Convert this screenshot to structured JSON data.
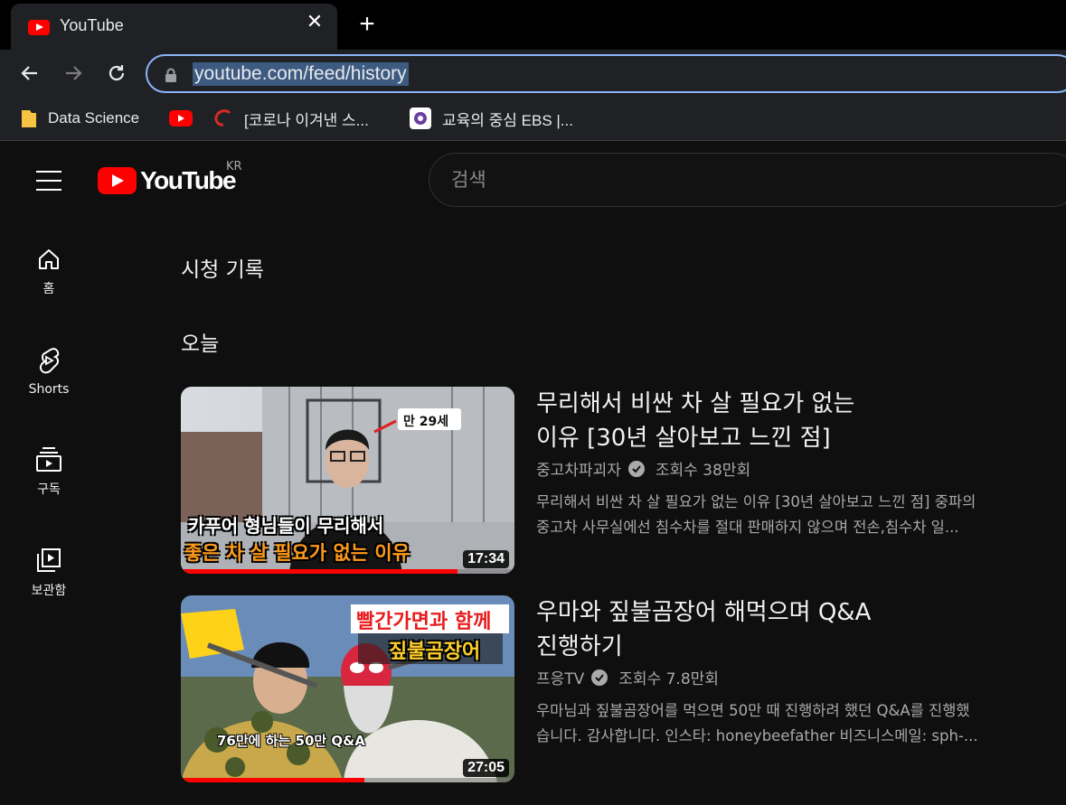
{
  "browser": {
    "tab_title": "YouTube",
    "tab_close": "✕",
    "new_tab": "+",
    "url": "youtube.com/feed/history",
    "bookmarks": [
      {
        "label": "Data Science",
        "icon": "folder-icon"
      },
      {
        "label": "",
        "icon": "youtube-icon"
      },
      {
        "label": "[코로나 이겨낸 스...",
        "icon": "red-swirl-icon"
      },
      {
        "label": "교육의 중심 EBS |...",
        "icon": "ebs-icon"
      }
    ]
  },
  "header": {
    "logo_text": "YouTube",
    "region": "KR",
    "search_placeholder": "검색"
  },
  "sidebar": {
    "items": [
      {
        "label": "홈",
        "icon": "home-icon"
      },
      {
        "label": "Shorts",
        "icon": "shorts-icon"
      },
      {
        "label": "구독",
        "icon": "subscriptions-icon"
      },
      {
        "label": "보관함",
        "icon": "library-icon"
      }
    ]
  },
  "main": {
    "page_title": "시청 기록",
    "section_title": "오늘",
    "videos": [
      {
        "title_line1": "무리해서 비싼 차 살 필요가 없는",
        "title_line2": "이유 [30년 살아보고 느낀 점]",
        "channel": "중고차파괴자",
        "views": "조회수 38만회",
        "desc_line1": "무리해서 비싼 차 살 필요가 없는 이유 [30년 살아보고 느낀 점] 중파의",
        "desc_line2": "중고차 사무실에선 침수차를 절대 판매하지 않으며 전손,침수차 일...",
        "duration": "17:34",
        "watched_fraction": 0.83,
        "thumb_caption1": "카푸어 형님들이 무리해서",
        "thumb_caption2": "좋은 차 살 필요가 없는 이유",
        "thumb_tag": "만 29세"
      },
      {
        "title_line1": "우마와 짚불곰장어 해먹으며 Q&A",
        "title_line2": "진행하기",
        "channel": "프응TV",
        "views": "조회수 7.8만회",
        "desc_line1": "우마님과 짚불곰장어를 먹으면 50만 때 진행하려 했던 Q&A를 진행했",
        "desc_line2": "습니다. 감사합니다. 인스타: honeybeefather 비즈니스메일: sph-...",
        "duration": "27:05",
        "watched_fraction": 0.55,
        "thumb_caption1": "빨간가면과 함께",
        "thumb_caption2": "짚불곰장어",
        "thumb_caption3": "76만에 하는 50만 Q&A"
      }
    ]
  },
  "colors": {
    "accent_red": "#ff0000",
    "omnibox_focus": "#8ab4f8",
    "background": "#0f0f0f"
  }
}
